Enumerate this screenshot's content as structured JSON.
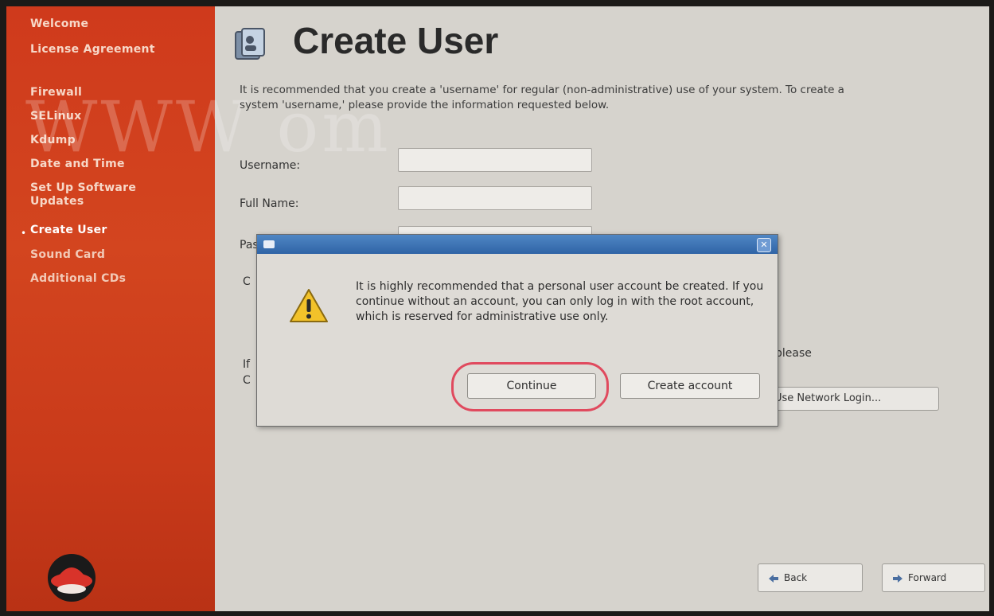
{
  "sidebar": {
    "items": [
      {
        "label": "Welcome"
      },
      {
        "label": "License Agreement"
      },
      {
        "label": "Firewall"
      },
      {
        "label": "SELinux"
      },
      {
        "label": "Kdump"
      },
      {
        "label": "Date and Time"
      },
      {
        "label": "Set Up Software Updates"
      },
      {
        "label": "Create User"
      },
      {
        "label": "Sound Card"
      },
      {
        "label": "Additional CDs"
      }
    ],
    "current_index": 7
  },
  "page": {
    "title": "Create User",
    "intro": "It is recommended that you create a 'username' for regular (non-administrative) use of your system. To create a system 'username,' please provide the information requested below.",
    "fields": [
      {
        "label": "Username:",
        "value": ""
      },
      {
        "label": "Full Name:",
        "value": ""
      },
      {
        "label": "Password:",
        "value": ""
      }
    ],
    "partial_c": "C",
    "partial_i": "If",
    "partial_c2": "C",
    "right_text": "please",
    "network_login_button": "Use Network Login...",
    "back_button": "Back",
    "forward_button": "Forward"
  },
  "dialog": {
    "message": "It is highly recommended that a personal user account be created. If you continue without an account, you can only log in with the root account, which is reserved for administrative use only.",
    "continue_button": "Continue",
    "create_account_button": "Create account"
  },
  "watermark": "WWW                                                     om",
  "colors": {
    "sidebar": "#cf3a1c",
    "dialog_titlebar": "#2f64a6",
    "highlight": "#e04a5e",
    "warning": "#f2c22a"
  }
}
